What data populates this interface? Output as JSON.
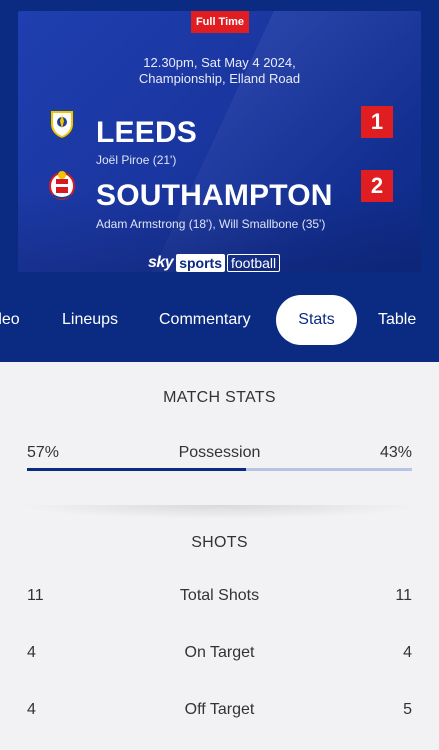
{
  "match": {
    "status": "Full Time",
    "kickoff": "12.30pm, Sat May 4 2024,",
    "venue": "Championship, Elland Road",
    "home": {
      "name": "LEEDS",
      "score": "1",
      "scorers": "Joël Piroe (21')",
      "crest": "leeds-crest-icon"
    },
    "away": {
      "name": "SOUTHAMPTON",
      "score": "2",
      "scorers": "Adam Armstrong (18'), Will Smallbone (35')",
      "crest": "southampton-crest-icon"
    },
    "broadcaster": {
      "sky": "sky",
      "sports": "sports",
      "channel": "football"
    }
  },
  "tabs": [
    {
      "label": "Video",
      "active": false
    },
    {
      "label": "Lineups",
      "active": false
    },
    {
      "label": "Commentary",
      "active": false
    },
    {
      "label": "Stats",
      "active": true
    },
    {
      "label": "Table",
      "active": false
    }
  ],
  "stats": {
    "title": "MATCH STATS",
    "possession": {
      "label": "Possession",
      "home": "57%",
      "away": "43%",
      "home_fraction": 0.57
    },
    "shots_title": "SHOTS",
    "shots": [
      {
        "label": "Total Shots",
        "home": "11",
        "away": "11"
      },
      {
        "label": "On Target",
        "home": "4",
        "away": "4"
      },
      {
        "label": "Off Target",
        "home": "4",
        "away": "5"
      }
    ]
  },
  "colors": {
    "header_bg": "#0b2b82",
    "score_red": "#e01e21",
    "possession_bar": "#0b2b82",
    "possession_track": "#b9c3e3"
  }
}
